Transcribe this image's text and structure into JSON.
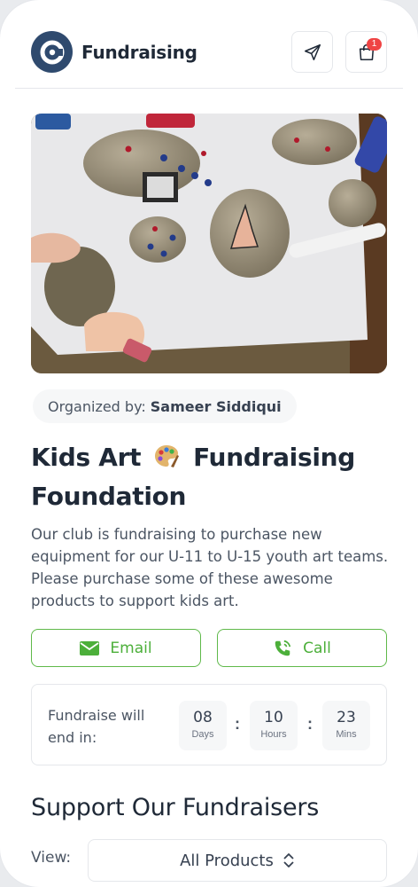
{
  "header": {
    "brand": "Fundraising",
    "logo_letter": "C",
    "cart_badge": "1",
    "icons": [
      "send-icon",
      "shopping-bag-icon"
    ]
  },
  "hero": {
    "image_description": "children painting rocks"
  },
  "organizer": {
    "label": "Organized by:",
    "name": "Sameer Siddiqui"
  },
  "campaign": {
    "title_part1": "Kids Art",
    "title_part2": "Fundraising Foundation",
    "description": "Our club is fundraising to purchase new equipment for our U-11 to U-15 youth art teams. Please purchase some of these awesome products to support kids art."
  },
  "actions": {
    "email_label": "Email",
    "call_label": "Call"
  },
  "countdown": {
    "label": "Fundraise will end in:",
    "days": "08",
    "days_unit": "Days",
    "hours": "10",
    "hours_unit": "Hours",
    "mins": "23",
    "mins_unit": "Mins",
    "separator": ":"
  },
  "products": {
    "section_title": "Support Our Fundraisers",
    "view_label": "View:",
    "view_selected": "All Products"
  },
  "colors": {
    "brand_blue": "#2f4a6e",
    "accent_green": "#4caf3a",
    "badge_red": "#ef4444"
  }
}
